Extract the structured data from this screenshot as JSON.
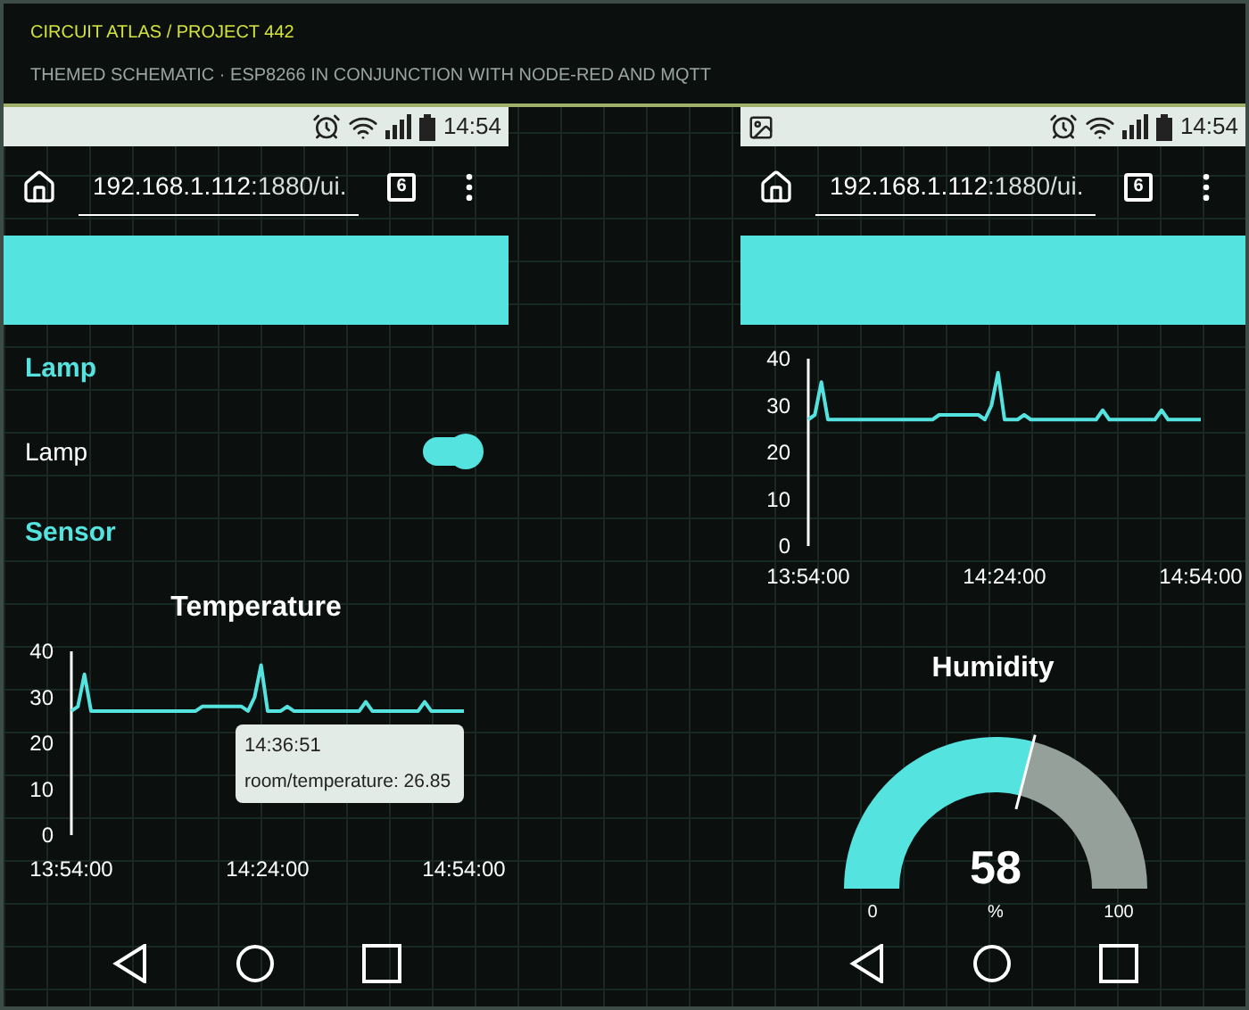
{
  "header": {
    "breadcrumb": "CIRCUIT ATLAS / PROJECT 442",
    "subtitle": "THEMED SCHEMATIC · ESP8266 IN CONJUNCTION WITH NODE-RED AND MQTT"
  },
  "phones": [
    {
      "status_bar": {
        "time": "14:54"
      },
      "address_bar": {
        "host": "192.168.1.112",
        "path": ":1880/ui.",
        "tab_count": "6"
      },
      "widgets": [
        {
          "kind": "heading",
          "text": "Lamp"
        },
        {
          "kind": "switch",
          "label": "Lamp",
          "on": true
        },
        {
          "kind": "heading",
          "text": "Sensor"
        },
        {
          "kind": "chart",
          "title": "Temperature",
          "tooltip": {
            "time": "14:36:51",
            "text": "room/temperature: 26.85"
          },
          "chart_data": {
            "type": "line",
            "ylim": [
              0,
              40
            ],
            "yticks": [
              0,
              10,
              20,
              30,
              40
            ],
            "categories": [
              "13:54:00",
              null,
              null,
              null,
              null,
              null,
              null,
              null,
              null,
              null,
              null,
              null,
              null,
              null,
              null,
              null,
              null,
              null,
              null,
              null,
              null,
              null,
              null,
              null,
              null,
              null,
              null,
              null,
              null,
              null,
              "14:24:00",
              null,
              null,
              null,
              null,
              null,
              null,
              null,
              null,
              null,
              null,
              null,
              null,
              null,
              null,
              null,
              null,
              null,
              null,
              null,
              null,
              null,
              null,
              null,
              null,
              null,
              null,
              null,
              null,
              null,
              "14:54:00"
            ],
            "series": [
              {
                "color": "#55e3df",
                "values": [
                  27,
                  28,
                  35,
                  27,
                  27,
                  27,
                  27,
                  27,
                  27,
                  27,
                  27,
                  27,
                  27,
                  27,
                  27,
                  27,
                  27,
                  27,
                  27,
                  27,
                  28,
                  28,
                  28,
                  28,
                  28,
                  28,
                  28,
                  27,
                  30,
                  37,
                  27,
                  27,
                  27,
                  28,
                  27,
                  27,
                  27,
                  27,
                  27,
                  27,
                  27,
                  27,
                  27,
                  27,
                  27,
                  29,
                  27,
                  27,
                  27,
                  27,
                  27,
                  27,
                  27,
                  27,
                  29,
                  27,
                  27,
                  27,
                  27,
                  27,
                  27
                ]
              }
            ]
          }
        }
      ]
    },
    {
      "status_bar": {
        "time": "14:54"
      },
      "address_bar": {
        "host": "192.168.1.112",
        "path": ":1880/ui.",
        "tab_count": "6"
      },
      "widgets": [
        {
          "kind": "chart",
          "chart_data": {
            "type": "line",
            "ylim": [
              0,
              40
            ],
            "yticks": [
              0,
              10,
              20,
              30,
              40
            ],
            "categories": [
              "13:54:00",
              null,
              null,
              null,
              null,
              null,
              null,
              null,
              null,
              null,
              null,
              null,
              null,
              null,
              null,
              null,
              null,
              null,
              null,
              null,
              null,
              null,
              null,
              null,
              null,
              null,
              null,
              null,
              null,
              null,
              "14:24:00",
              null,
              null,
              null,
              null,
              null,
              null,
              null,
              null,
              null,
              null,
              null,
              null,
              null,
              null,
              null,
              null,
              null,
              null,
              null,
              null,
              null,
              null,
              null,
              null,
              null,
              null,
              null,
              null,
              null,
              "14:54:00"
            ],
            "series": [
              {
                "color": "#55e3df",
                "values": [
                  27,
                  28,
                  35,
                  27,
                  27,
                  27,
                  27,
                  27,
                  27,
                  27,
                  27,
                  27,
                  27,
                  27,
                  27,
                  27,
                  27,
                  27,
                  27,
                  27,
                  28,
                  28,
                  28,
                  28,
                  28,
                  28,
                  28,
                  27,
                  30,
                  37,
                  27,
                  27,
                  27,
                  28,
                  27,
                  27,
                  27,
                  27,
                  27,
                  27,
                  27,
                  27,
                  27,
                  27,
                  27,
                  29,
                  27,
                  27,
                  27,
                  27,
                  27,
                  27,
                  27,
                  27,
                  29,
                  27,
                  27,
                  27,
                  27,
                  27,
                  27
                ]
              }
            ]
          }
        },
        {
          "kind": "gauge",
          "title": "Humidity",
          "value": "58",
          "unit": "%",
          "min": "0",
          "max": "100",
          "level": 0.58
        }
      ]
    }
  ]
}
